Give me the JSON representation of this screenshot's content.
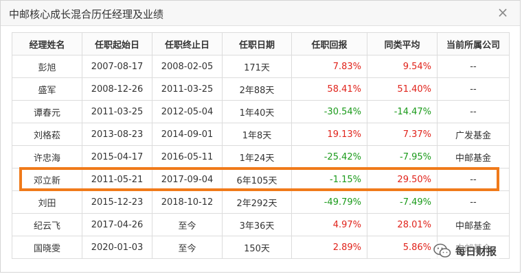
{
  "dialog": {
    "title": "中邮核心成长混合历任经理及业绩",
    "close_glyph": "×"
  },
  "table": {
    "headers": [
      "经理姓名",
      "任职起始日",
      "任职终止日",
      "任职日期",
      "任职回报",
      "同类平均",
      "当前所属公司"
    ],
    "rows": [
      {
        "name": "彭旭",
        "start": "2007-08-17",
        "end": "2008-02-05",
        "duration": "171天",
        "return": "7.83%",
        "avg": "9.54%",
        "company": "--",
        "return_dir": "up",
        "avg_dir": "up"
      },
      {
        "name": "盛军",
        "start": "2008-12-26",
        "end": "2011-03-25",
        "duration": "2年88天",
        "return": "58.41%",
        "avg": "51.40%",
        "company": "--",
        "return_dir": "up",
        "avg_dir": "up"
      },
      {
        "name": "谭春元",
        "start": "2011-03-25",
        "end": "2012-05-04",
        "duration": "1年40天",
        "return": "-30.54%",
        "avg": "-14.47%",
        "company": "--",
        "return_dir": "down",
        "avg_dir": "down"
      },
      {
        "name": "刘格菘",
        "start": "2013-08-23",
        "end": "2014-09-01",
        "duration": "1年8天",
        "return": "19.13%",
        "avg": "7.37%",
        "company": "广发基金",
        "return_dir": "up",
        "avg_dir": "up"
      },
      {
        "name": "许忠海",
        "start": "2015-04-17",
        "end": "2016-05-11",
        "duration": "1年24天",
        "return": "-25.42%",
        "avg": "-7.95%",
        "company": "中邮基金",
        "return_dir": "down",
        "avg_dir": "down"
      },
      {
        "name": "邓立新",
        "start": "2011-05-21",
        "end": "2017-09-04",
        "duration": "6年105天",
        "return": "-1.15%",
        "avg": "29.50%",
        "company": "--",
        "return_dir": "down",
        "avg_dir": "up"
      },
      {
        "name": "刘田",
        "start": "2015-12-23",
        "end": "2018-10-12",
        "duration": "2年292天",
        "return": "-49.79%",
        "avg": "-7.49%",
        "company": "--",
        "return_dir": "down",
        "avg_dir": "down"
      },
      {
        "name": "纪云飞",
        "start": "2017-04-26",
        "end": "至今",
        "duration": "3年36天",
        "return": "4.97%",
        "avg": "28.01%",
        "company": "中邮基金",
        "return_dir": "up",
        "avg_dir": "up"
      },
      {
        "name": "国晓雯",
        "start": "2020-01-03",
        "end": "至今",
        "duration": "150天",
        "return": "2.89%",
        "avg": "5.86%",
        "company": "中邮基金",
        "return_dir": "up",
        "avg_dir": "up"
      }
    ],
    "highlighted_row": 5
  },
  "watermark": {
    "text": "每日财报",
    "icon": "wechat-icon"
  },
  "colors": {
    "positive": "#e0221a",
    "negative": "#1a9a1a",
    "highlight_border": "#f07a1a"
  }
}
